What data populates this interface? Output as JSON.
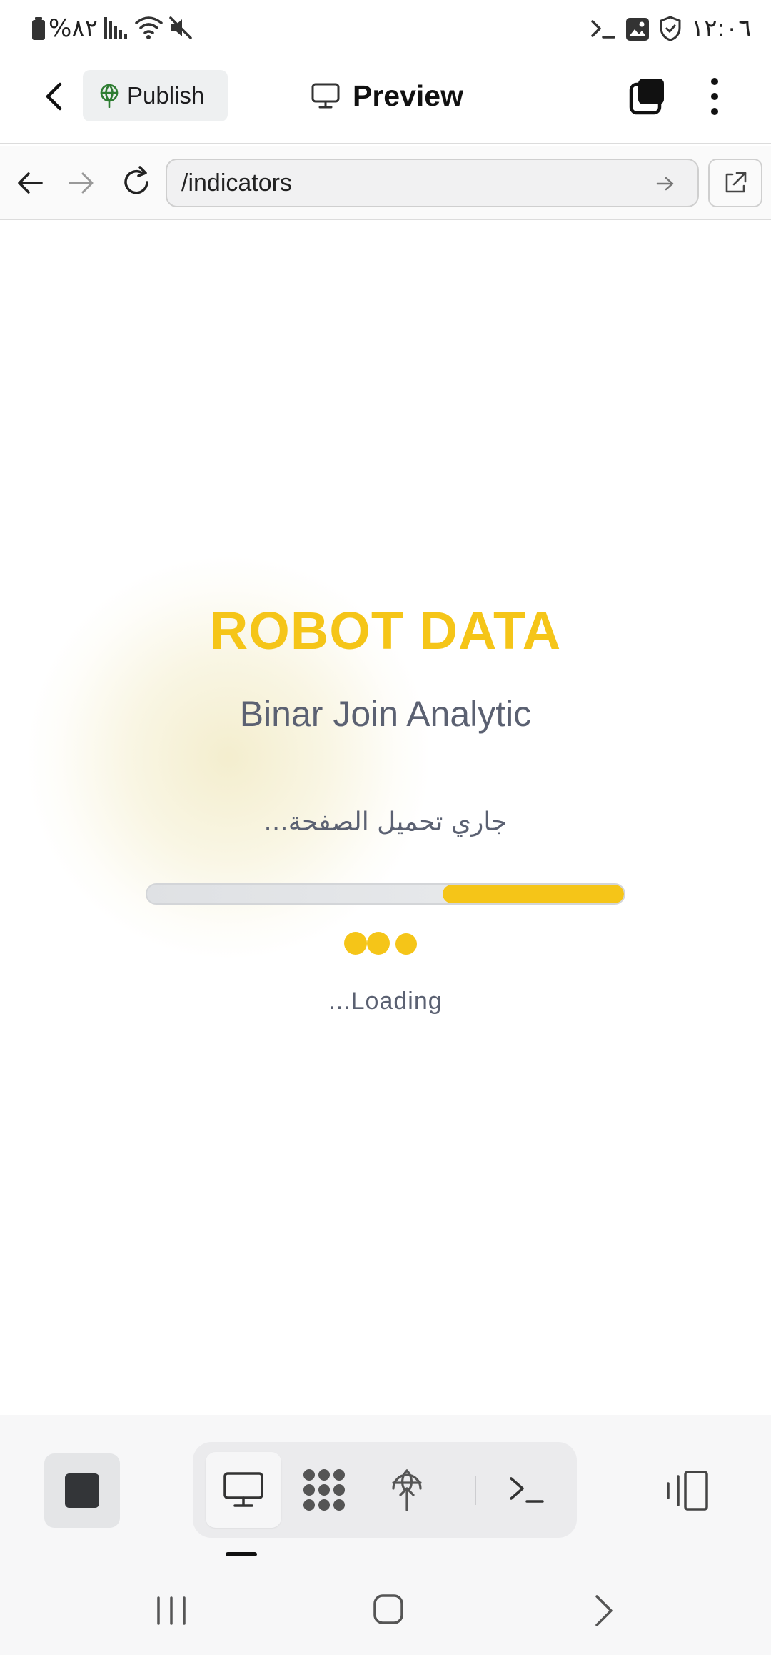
{
  "status_bar": {
    "battery": "%٨٢",
    "time": "١٢:٠٦"
  },
  "header": {
    "publish_label": "Publish",
    "title": "Preview"
  },
  "browser": {
    "url": "/indicators"
  },
  "page": {
    "brand": "ROBOT DATA",
    "subtitle": "Binar Join Analytic",
    "loading_ar": "جاري تحميل الصفحة...",
    "loading_en": "...Loading",
    "progress": {
      "start": 0.62,
      "end": 1.0
    }
  },
  "colors": {
    "accent": "#f5c518",
    "muted_text": "#5b6172",
    "publish_icon": "#2e7d32"
  },
  "icons": {
    "header": [
      "back-arrow-icon",
      "globe-icon",
      "monitor-icon",
      "tabs-icon",
      "more-vertical-icon"
    ],
    "browser": [
      "arrow-left-icon",
      "arrow-right-icon",
      "reload-icon",
      "go-arrow-icon",
      "external-link-icon"
    ],
    "toolbar": [
      "stop-icon",
      "monitor-icon",
      "packages-icon",
      "deploy-icon",
      "terminal-icon",
      "device-toggle-icon"
    ],
    "navbar": [
      "recents-icon",
      "home-icon",
      "back-icon"
    ]
  }
}
